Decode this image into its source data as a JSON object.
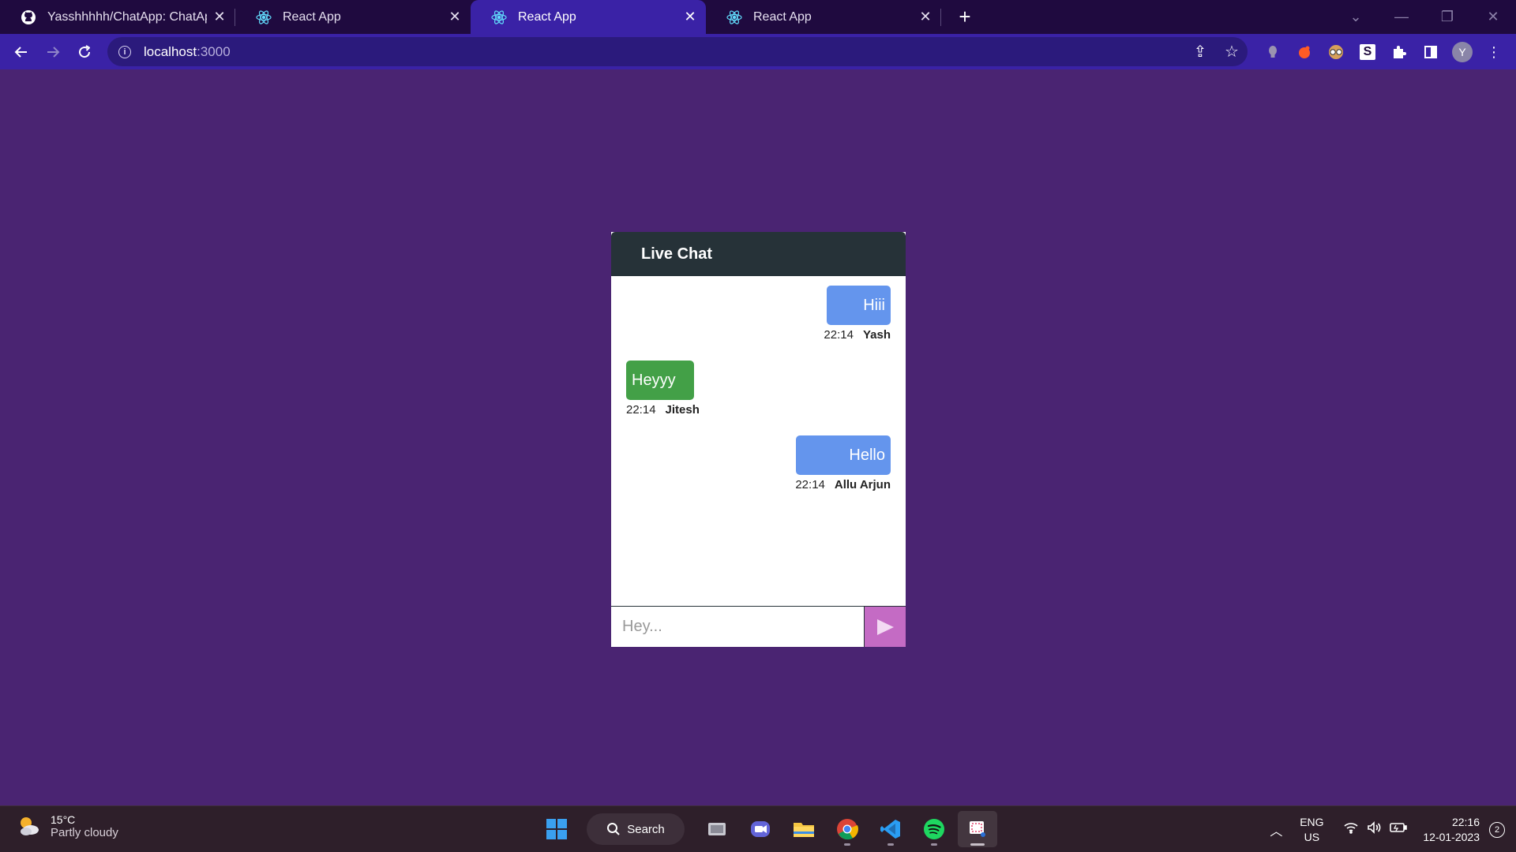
{
  "browser": {
    "tabs": [
      {
        "title": "Yasshhhhh/ChatApp: ChatApp made",
        "icon": "github-icon",
        "active": false
      },
      {
        "title": "React App",
        "icon": "react-icon",
        "active": false
      },
      {
        "title": "React App",
        "icon": "react-icon",
        "active": true
      },
      {
        "title": "React App",
        "icon": "react-icon",
        "active": false
      }
    ],
    "address": {
      "host": "localhost",
      "port": ":3000"
    },
    "profile_initial": "Y"
  },
  "chat": {
    "title": "Live Chat",
    "messages": [
      {
        "text": "Hiii",
        "time": "22:14",
        "author": "Yash",
        "side": "you"
      },
      {
        "text": "Heyyy",
        "time": "22:14",
        "author": "Jitesh",
        "side": "other"
      },
      {
        "text": "Hello",
        "time": "22:14",
        "author": "Allu Arjun",
        "side": "you"
      }
    ],
    "input": {
      "placeholder": "Hey...",
      "value": ""
    },
    "send_icon": "play-triangle-icon"
  },
  "colors": {
    "page_bg": "#4a2472",
    "header_bg": "#263238",
    "bubble_you": "#6495ed",
    "bubble_other": "#43a047",
    "send_button": "#c46bc4"
  },
  "taskbar": {
    "weather": {
      "temp": "15°C",
      "condition": "Partly cloudy"
    },
    "search_label": "Search",
    "language": {
      "line1": "ENG",
      "line2": "US"
    },
    "clock": {
      "time": "22:16",
      "date": "12-01-2023"
    },
    "notifications": "2"
  }
}
